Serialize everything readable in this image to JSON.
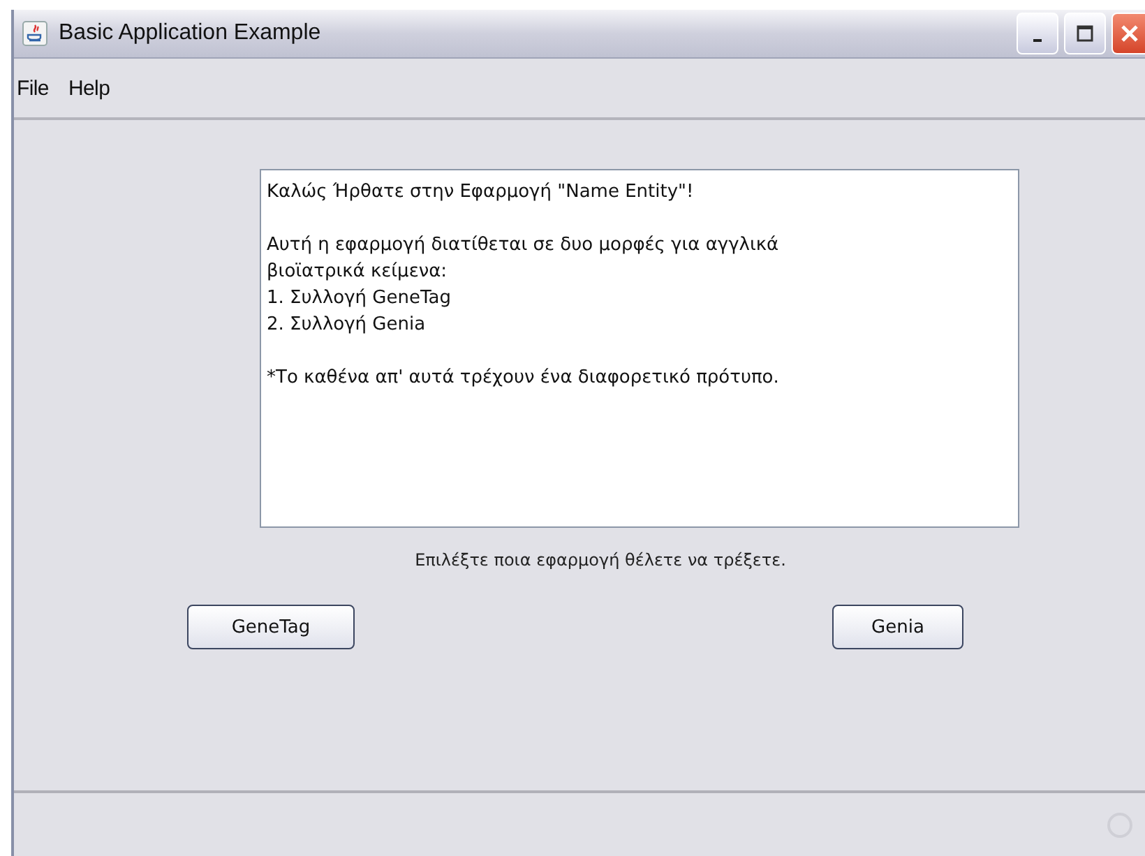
{
  "window": {
    "title": "Basic Application Example"
  },
  "menu": [
    "File",
    "Help"
  ],
  "text_area": {
    "paragraphs": [
      [
        "Καλώς Ήρθατε στην Εφαρμογή \"Name Entity\"!"
      ],
      [
        "Αυτή η εφαρμογή διατίθεται σε δυο μορφές για αγγλικά",
        "βιοϊατρικά κείμενα:",
        "1. Συλλογή GeneTag",
        "2. Συλλογή Genia"
      ],
      [
        "*Το καθένα απ' αυτά τρέχουν ένα διαφορετικό πρότυπο."
      ]
    ]
  },
  "prompt": "Επιλέξτε ποια εφαρμογή θέλετε να τρέξετε.",
  "buttons": [
    "GeneTag",
    "Genia"
  ]
}
